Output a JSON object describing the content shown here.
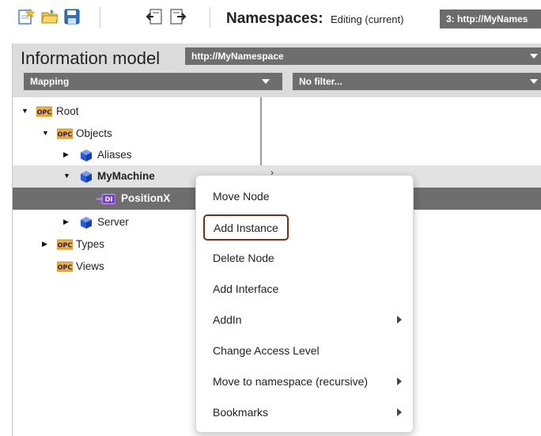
{
  "toolbar": {
    "icons": [
      "new-file-icon",
      "open-folder-icon",
      "save-icon",
      "import-icon",
      "export-icon"
    ],
    "namespaces_label": "Namespaces:",
    "editing_label": "Editing (current)",
    "namespace_selected": "3: http://MyNames"
  },
  "info_model": {
    "title": "Information model",
    "namespace": "http://MyNamespace"
  },
  "mapping": {
    "selected": "Mapping"
  },
  "filter": {
    "selected": "No filter..."
  },
  "tree": {
    "root": "Root",
    "objects": "Objects",
    "aliases": "Aliases",
    "mymachine": "MyMachine",
    "positionx": "PositionX",
    "server": "Server",
    "types": "Types",
    "views": "Views",
    "opc_badge": "OPC",
    "di_badge": "DI"
  },
  "context_menu": {
    "items": [
      {
        "label": "Move Node"
      },
      {
        "label": "Add Instance"
      },
      {
        "label": "Delete Node"
      },
      {
        "label": "Add Interface"
      },
      {
        "label": "AddIn"
      },
      {
        "label": "Change Access Level"
      },
      {
        "label": "Move to namespace (recursive)"
      },
      {
        "label": "Bookmarks"
      }
    ]
  },
  "colors": {
    "header_bg": "#dcdcdc",
    "dropdown_bg": "#6e6e6e",
    "selected_row": "#6e6e6e",
    "highlight_border": "#7a2b1c",
    "opc_orange": "#f0a020",
    "object_blue": "#2a5bd7",
    "variable_purple": "#7b3fd0"
  }
}
